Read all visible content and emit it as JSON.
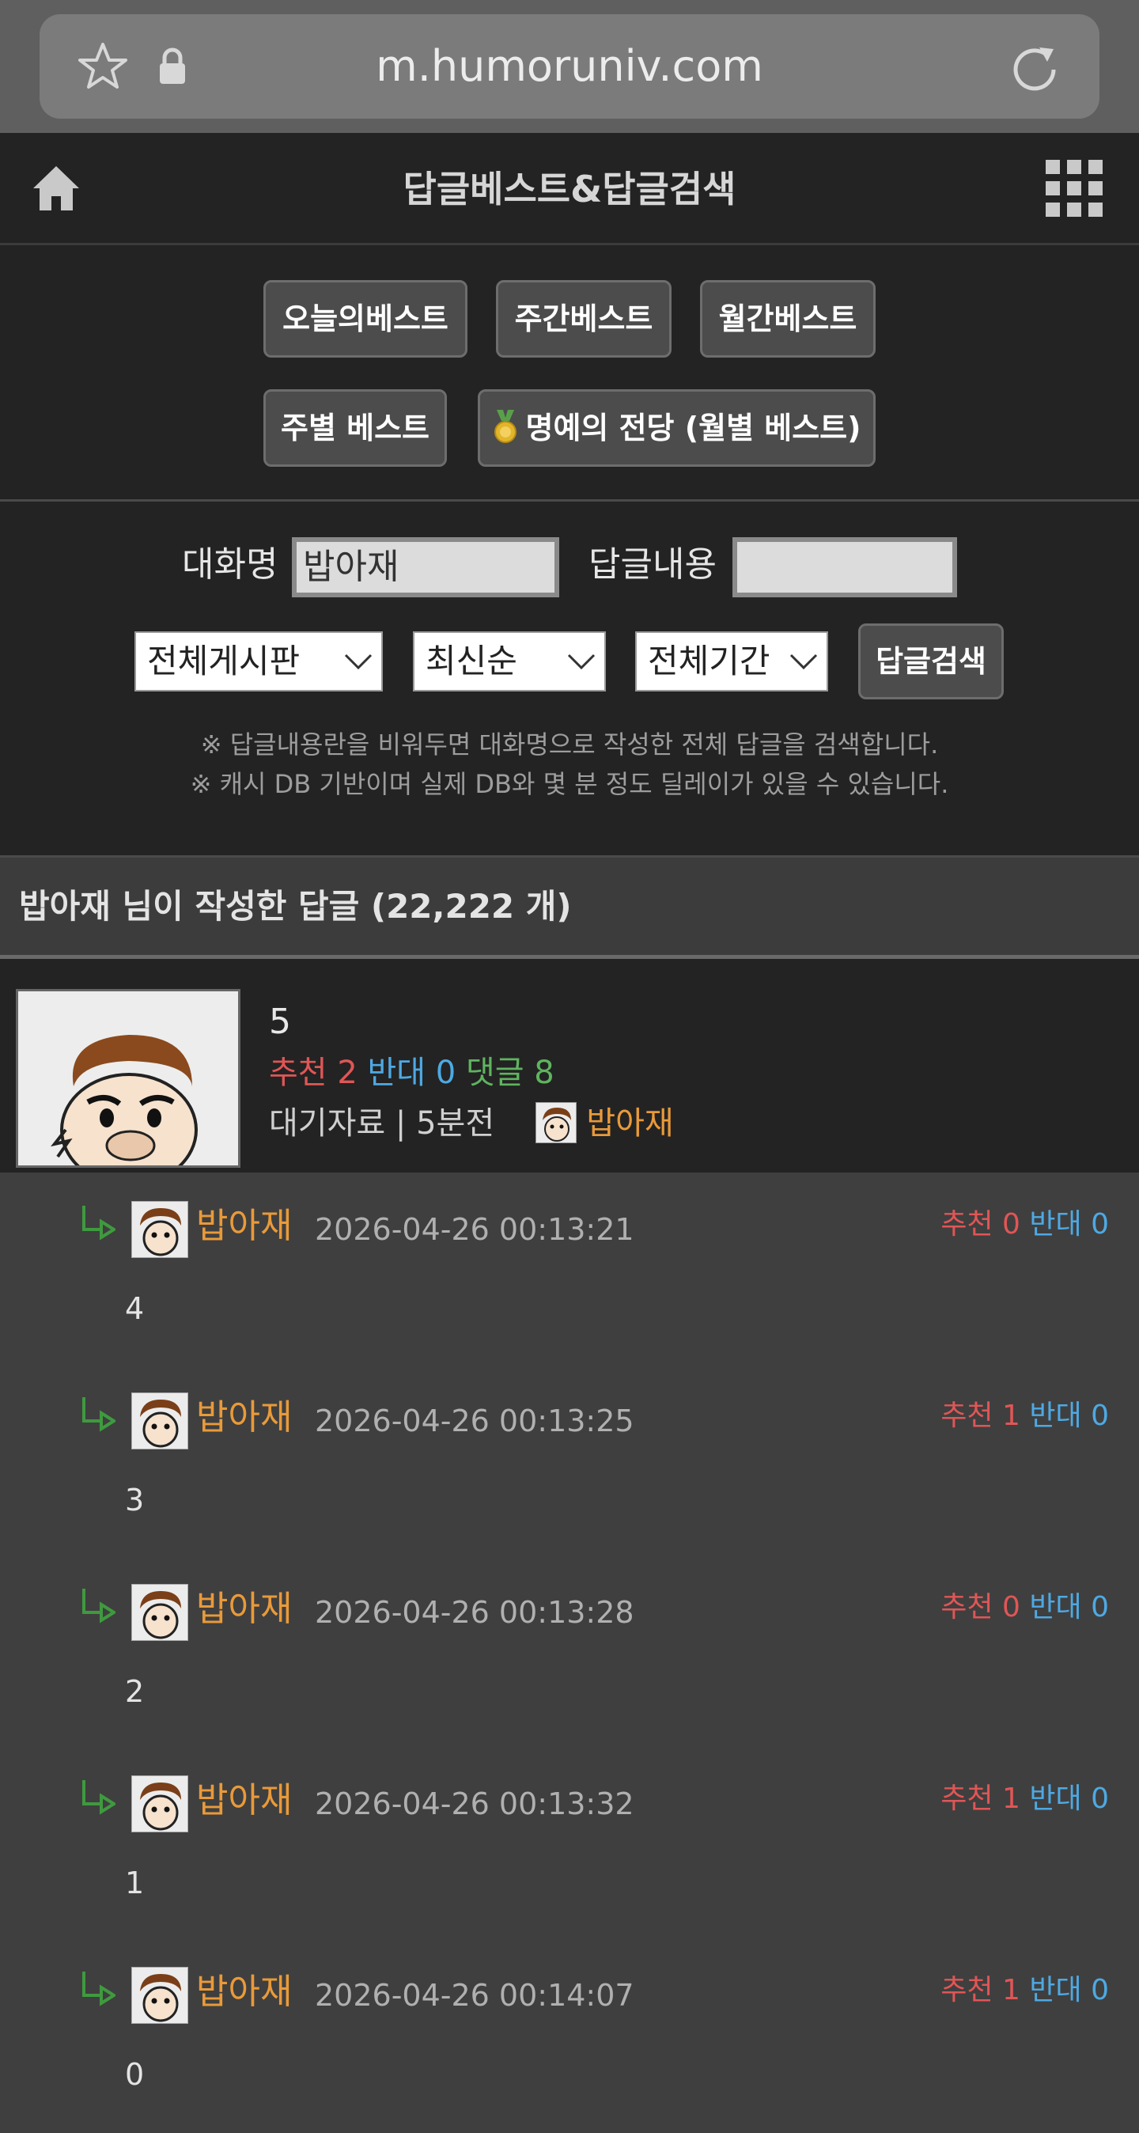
{
  "browser": {
    "url": "m.humoruniv.com"
  },
  "header": {
    "title": "답글베스트&답글검색"
  },
  "best_buttons": {
    "today": "오늘의베스트",
    "weekly": "주간베스트",
    "monthly": "월간베스트",
    "by_week": "주별 베스트",
    "hall_of_fame": "명예의 전당 (월별 베스트)"
  },
  "search": {
    "nickname_label": "대화명",
    "nickname_value": "밥아재",
    "content_label": "답글내용",
    "content_value": "",
    "board_select": "전체게시판",
    "sort_select": "최신순",
    "period_select": "전체기간",
    "submit_label": "답글검색",
    "note1": "※ 답글내용란을 비워두면 대화명으로 작성한 전체 답글을 검색합니다.",
    "note2": "※ 캐시 DB 기반이며 실제 DB와 몇 분 정도 딜레이가 있을 수 있습니다."
  },
  "results": {
    "heading": "밥아재 님이 작성한 답글 (22,222 개)"
  },
  "post": {
    "title": "5",
    "recommend_label": "추천 2",
    "oppose_label": "반대 0",
    "comments_label": "댓글 8",
    "meta": "대기자료 | 5분전",
    "author": "밥아재"
  },
  "comments": [
    {
      "author": "밥아재",
      "date": "2026-04-26 00:13:21",
      "rec": "추천 0",
      "opp": "반대 0",
      "body": "4"
    },
    {
      "author": "밥아재",
      "date": "2026-04-26 00:13:25",
      "rec": "추천 1",
      "opp": "반대 0",
      "body": "3"
    },
    {
      "author": "밥아재",
      "date": "2026-04-26 00:13:28",
      "rec": "추천 0",
      "opp": "반대 0",
      "body": "2"
    },
    {
      "author": "밥아재",
      "date": "2026-04-26 00:13:32",
      "rec": "추천 1",
      "opp": "반대 0",
      "body": "1"
    },
    {
      "author": "밥아재",
      "date": "2026-04-26 00:14:07",
      "rec": "추천 1",
      "opp": "반대 0",
      "body": "0"
    }
  ],
  "colors": {
    "recommend": "#e05656",
    "oppose": "#4ea9e3",
    "comments": "#5fb45f",
    "author": "#e99a3a"
  }
}
